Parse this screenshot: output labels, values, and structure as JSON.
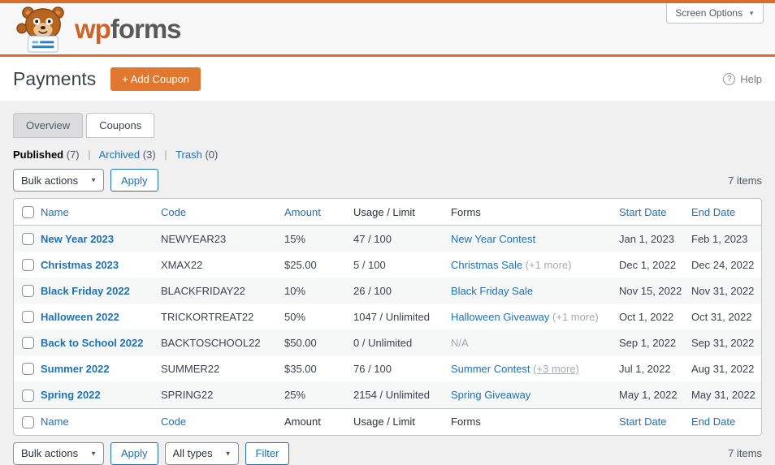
{
  "screen_options": {
    "label": "Screen Options"
  },
  "logo": {
    "wp": "wp",
    "forms": "forms"
  },
  "page": {
    "title": "Payments",
    "add_coupon_label": "+ Add Coupon",
    "help_label": "Help",
    "help_icon": "?"
  },
  "tabs": [
    {
      "label": "Overview",
      "active": false
    },
    {
      "label": "Coupons",
      "active": true
    }
  ],
  "filters": {
    "separator": "|",
    "items": [
      {
        "label": "Published",
        "count": "(7)",
        "active": true
      },
      {
        "label": "Archived",
        "count": "(3)",
        "active": false
      },
      {
        "label": "Trash",
        "count": "(0)",
        "active": false
      }
    ]
  },
  "toolbar_top": {
    "bulk_actions": "Bulk actions",
    "apply": "Apply",
    "items_count": "7 items"
  },
  "toolbar_bottom": {
    "bulk_actions": "Bulk actions",
    "apply": "Apply",
    "types_filter": "All types",
    "filter": "Filter",
    "items_count": "7 items"
  },
  "table": {
    "columns": [
      "Name",
      "Code",
      "Amount",
      "Usage / Limit",
      "Forms",
      "Start Date",
      "End Date"
    ],
    "rows": [
      {
        "name": "New Year 2023",
        "code": "NEWYEAR23",
        "amount": "15%",
        "usage": "47 / 100",
        "form": "New Year Contest",
        "form_link": true,
        "form_extra": "",
        "extra_underline": false,
        "start": "Jan 1, 2023",
        "end": "Feb 1, 2023"
      },
      {
        "name": "Christmas 2023",
        "code": "XMAX22",
        "amount": "$25.00",
        "usage": "5 / 100",
        "form": "Christmas Sale",
        "form_link": true,
        "form_extra": "(+1 more)",
        "extra_underline": false,
        "start": "Dec 1, 2022",
        "end": "Dec 24, 2022"
      },
      {
        "name": "Black Friday 2022",
        "code": "BLACKFRIDAY22",
        "amount": "10%",
        "usage": "26 / 100",
        "form": "Black Friday Sale",
        "form_link": true,
        "form_extra": "",
        "extra_underline": false,
        "start": "Nov 15, 2022",
        "end": "Nov 31, 2022"
      },
      {
        "name": "Halloween 2022",
        "code": "TRICKORTREAT22",
        "amount": "50%",
        "usage": "1047 / Unlimited",
        "form": "Halloween Giveaway",
        "form_link": true,
        "form_extra": "(+1 more)",
        "extra_underline": false,
        "start": "Oct 1, 2022",
        "end": "Oct 31, 2022"
      },
      {
        "name": "Back to School 2022",
        "code": "BACKTOSCHOOL22",
        "amount": "$50.00",
        "usage": "0 / Unlimited",
        "form": "N/A",
        "form_link": false,
        "form_extra": "",
        "extra_underline": false,
        "start": "Sep 1, 2022",
        "end": "Sep 31, 2022"
      },
      {
        "name": "Summer 2022",
        "code": "SUMMER22",
        "amount": "$35.00",
        "usage": "76 / 100",
        "form": "Summer Contest",
        "form_link": true,
        "form_extra": "(+3 more)",
        "extra_underline": true,
        "start": "Jul 1, 2022",
        "end": "Aug 31, 2022"
      },
      {
        "name": "Spring 2022",
        "code": "SPRING22",
        "amount": "25%",
        "usage": "2154 / Unlimited",
        "form": "Spring Giveaway",
        "form_link": true,
        "form_extra": "",
        "extra_underline": false,
        "start": "May 1, 2022",
        "end": "May 31, 2022"
      }
    ]
  },
  "colors": {
    "accent_orange": "#e27730",
    "topbar_orange": "#d66e2f",
    "link_blue": "#2271b1",
    "muted_gray": "#a7aaad"
  }
}
